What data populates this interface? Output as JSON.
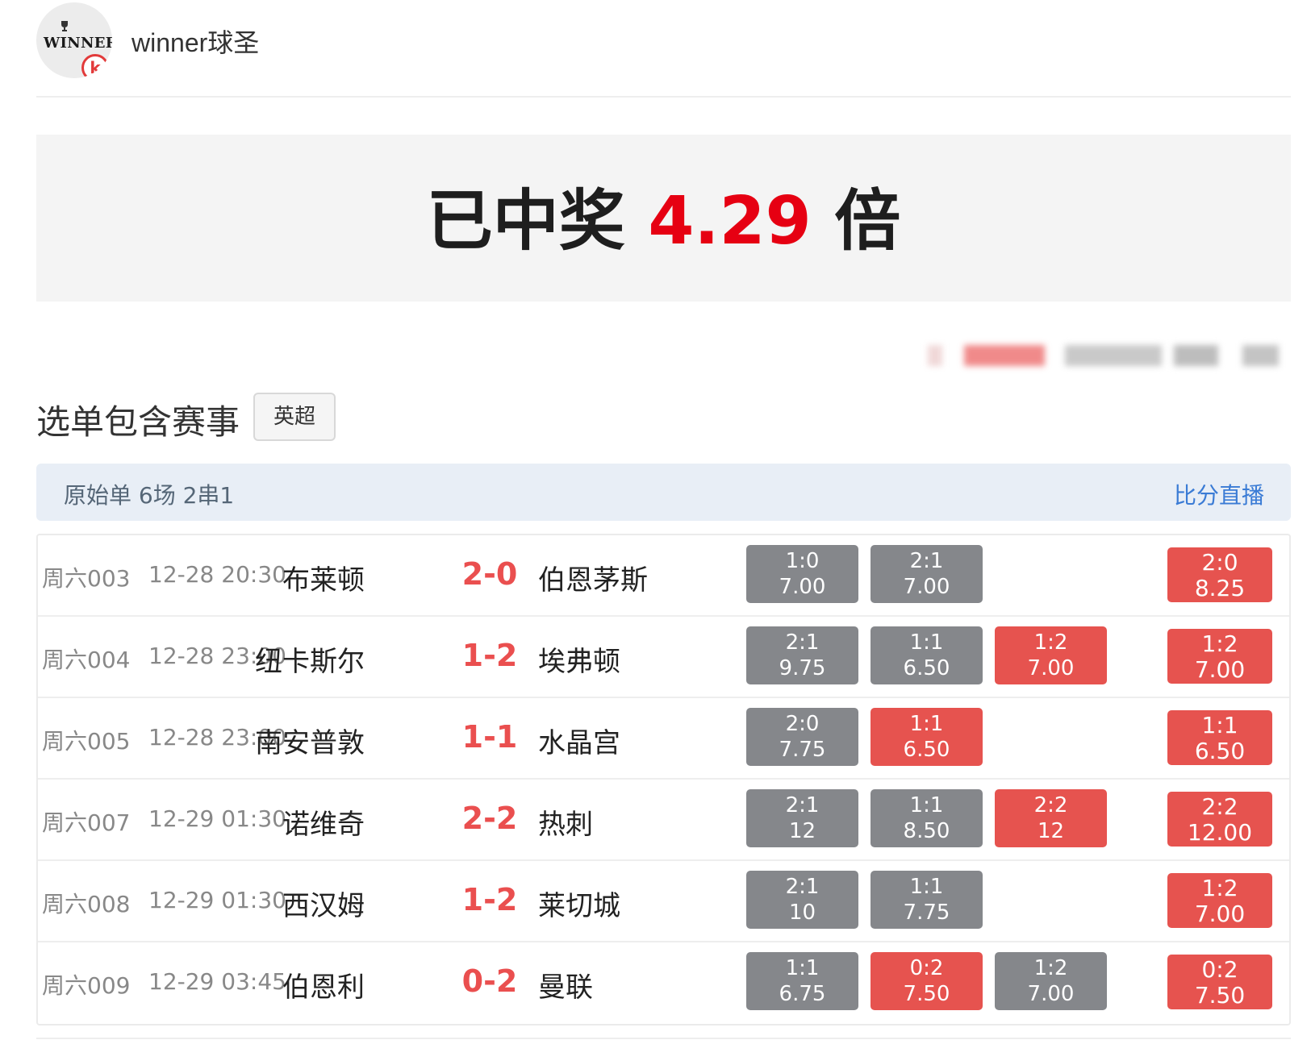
{
  "header": {
    "logo_text": "WINNER",
    "logo_badge": "k",
    "account_name": "winner球圣"
  },
  "banner": {
    "prefix": "已中奖",
    "multiplier": "4.29",
    "suffix": "倍"
  },
  "section": {
    "title": "选单包含赛事",
    "league_tag": "英超"
  },
  "order": {
    "info": "原始单  6场 2串1",
    "live_link": "比分直播"
  },
  "colors": {
    "accent_red": "#e60012",
    "pick_red": "#e6534f",
    "pick_gray": "#85878b",
    "link_blue": "#3a7bd5",
    "order_bar_bg": "#e8eef6"
  },
  "matches": [
    {
      "code": "周六003",
      "time": "12-28 20:30",
      "home": "布莱顿",
      "score": "2-0",
      "away": "伯恩茅斯",
      "picks": [
        {
          "sel": "1:0",
          "odd": "7.00",
          "hit": false
        },
        {
          "sel": "2:1",
          "odd": "7.00",
          "hit": false
        }
      ],
      "result": {
        "sel": "2:0",
        "odd": "8.25"
      }
    },
    {
      "code": "周六004",
      "time": "12-28 23:00",
      "home": "纽卡斯尔",
      "score": "1-2",
      "away": "埃弗顿",
      "picks": [
        {
          "sel": "2:1",
          "odd": "9.75",
          "hit": false
        },
        {
          "sel": "1:1",
          "odd": "6.50",
          "hit": false
        },
        {
          "sel": "1:2",
          "odd": "7.00",
          "hit": true
        }
      ],
      "result": {
        "sel": "1:2",
        "odd": "7.00"
      }
    },
    {
      "code": "周六005",
      "time": "12-28 23:00",
      "home": "南安普敦",
      "score": "1-1",
      "away": "水晶宫",
      "picks": [
        {
          "sel": "2:0",
          "odd": "7.75",
          "hit": false
        },
        {
          "sel": "1:1",
          "odd": "6.50",
          "hit": true
        }
      ],
      "result": {
        "sel": "1:1",
        "odd": "6.50"
      }
    },
    {
      "code": "周六007",
      "time": "12-29 01:30",
      "home": "诺维奇",
      "score": "2-2",
      "away": "热刺",
      "picks": [
        {
          "sel": "2:1",
          "odd": "12",
          "hit": false
        },
        {
          "sel": "1:1",
          "odd": "8.50",
          "hit": false
        },
        {
          "sel": "2:2",
          "odd": "12",
          "hit": true
        }
      ],
      "result": {
        "sel": "2:2",
        "odd": "12.00"
      }
    },
    {
      "code": "周六008",
      "time": "12-29 01:30",
      "home": "西汉姆",
      "score": "1-2",
      "away": "莱切城",
      "picks": [
        {
          "sel": "2:1",
          "odd": "10",
          "hit": false
        },
        {
          "sel": "1:1",
          "odd": "7.75",
          "hit": false
        }
      ],
      "result": {
        "sel": "1:2",
        "odd": "7.00"
      }
    },
    {
      "code": "周六009",
      "time": "12-29 03:45",
      "home": "伯恩利",
      "score": "0-2",
      "away": "曼联",
      "picks": [
        {
          "sel": "1:1",
          "odd": "6.75",
          "hit": false
        },
        {
          "sel": "0:2",
          "odd": "7.50",
          "hit": true
        },
        {
          "sel": "1:2",
          "odd": "7.00",
          "hit": false
        }
      ],
      "result": {
        "sel": "0:2",
        "odd": "7.50"
      }
    }
  ]
}
